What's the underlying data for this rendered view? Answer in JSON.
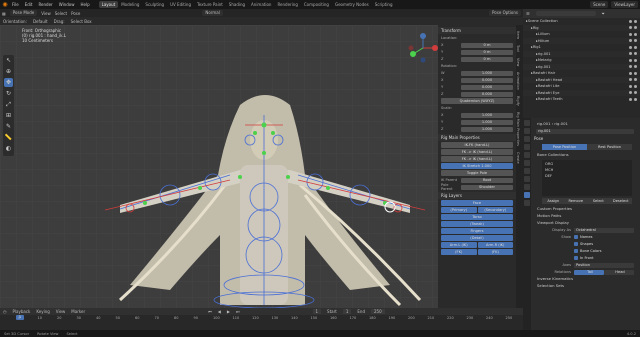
{
  "topbar": {
    "menus": [
      "File",
      "Edit",
      "Render",
      "Window",
      "Help"
    ],
    "workspaces": [
      "Layout",
      "Modeling",
      "Sculpting",
      "UV Editing",
      "Texture Paint",
      "Shading",
      "Animation",
      "Rendering",
      "Compositing",
      "Geometry Nodes",
      "Scripting"
    ],
    "active_workspace": "Layout",
    "scene": "Scene",
    "view_layer": "ViewLayer"
  },
  "header": {
    "mode": "Pose Mode",
    "view": "View",
    "select": "Select",
    "pose": "Pose",
    "orientation_label": "Orientation:",
    "orientation_value": "Default",
    "drag_label": "Drag:",
    "drag_value": "Select Box",
    "transform": "Normal",
    "pose_options": "Pose Options"
  },
  "viewport": {
    "info_line1": "Front: Orthographic",
    "info_line2": "(0) rig.001 : hand_ik.L",
    "info_line3": "10 Centimeters"
  },
  "npanel": {
    "transform_title": "Transform",
    "location_label": "Location:",
    "rotation_label": "Rotation:",
    "scale_label": "Scale:",
    "axes": [
      "X",
      "Y",
      "Z"
    ],
    "location_values": [
      "0 m",
      "0 m",
      "0 m"
    ],
    "rotation_w": "1.000",
    "rotation_values": [
      "0.000",
      "0.000",
      "0.000"
    ],
    "rotation_mode": "Quaternion (WXYZ)",
    "scale_values": [
      "1.000",
      "1.000",
      "1.000"
    ],
    "rig_main_title": "Rig Main Properties",
    "fk_ik_1": "FK -> IK (hand.L)",
    "fk_ik_2": "FK -> IK (hand.L)",
    "ik_switch_1": "IK-FK (hand.L)",
    "ik_switch_2": "IK Stretch",
    "ik_stretch_val": "1.000",
    "toggle_pole": "Toggle Pole",
    "ik_parent_label": "IK Parent",
    "ik_parent_val": "Root",
    "pole_parent_label": "Pole Parent",
    "pole_parent_val": "Shoulder",
    "rig_layers_title": "Rig Layers",
    "layers": [
      [
        "Face"
      ],
      [
        "(Primary)",
        "(Secondary)"
      ],
      [
        "Torso"
      ],
      [
        "(Tweak)"
      ],
      [
        "Fingers"
      ],
      [
        "(Detail)"
      ],
      [
        "Arm.L (IK)",
        "Arm.R (IK)"
      ],
      [
        "(FK)",
        "(FK)"
      ]
    ]
  },
  "side_tabs": [
    "Item",
    "Tool",
    "View",
    "Animation",
    "Rigify",
    "Rig Main Properties",
    "Create"
  ],
  "outliner": {
    "title": "Scene Collection",
    "rows": [
      {
        "label": "Scene Collection",
        "indent": 0,
        "sel": false
      },
      {
        "label": "Rig",
        "indent": 1,
        "sel": false
      },
      {
        "label": "Lillium",
        "indent": 2,
        "sel": false
      },
      {
        "label": "Hilium",
        "indent": 2,
        "sel": false
      },
      {
        "label": "Rig1",
        "indent": 1,
        "sel": false
      },
      {
        "label": "rig.001",
        "indent": 2,
        "sel": true
      },
      {
        "label": "Metarig",
        "indent": 2,
        "sel": false
      },
      {
        "label": "rig.001",
        "indent": 2,
        "sel": false
      },
      {
        "label": "Rastafri Hair",
        "indent": 1,
        "sel": false
      },
      {
        "label": "Rastafri Head",
        "indent": 2,
        "sel": false
      },
      {
        "label": "Rastafri Lite",
        "indent": 2,
        "sel": false
      },
      {
        "label": "Rastafri Eye",
        "indent": 2,
        "sel": false
      },
      {
        "label": "Rastafri Teeth",
        "indent": 2,
        "sel": false
      }
    ]
  },
  "properties": {
    "object_name": "rig.001",
    "data_name": "rig.001",
    "pose_title": "Pose",
    "pose_position": "Pose Position",
    "rest_position": "Rest Position",
    "bone_collections_title": "Bone Collections",
    "bone_collections": [
      "ORG",
      "MCH",
      "DEF"
    ],
    "bc_buttons": [
      "Assign",
      "Remove",
      "Select",
      "Deselect"
    ],
    "custom_properties": "Custom Properties",
    "motion_paths": "Motion Paths",
    "viewport_display": "Viewport Display",
    "display_as_label": "Display As",
    "display_as_value": "Octahedral",
    "show_label": "Show",
    "show_items": [
      "Names",
      "Shapes",
      "Bone Colors",
      "In Front"
    ],
    "axes_label": "Axes",
    "axes_value": "Position",
    "relations_label": "Relations",
    "relations_opts": [
      "Tail",
      "Head"
    ],
    "inverse_kinematics": "Inverse Kinematics",
    "selection_sets": "Selection Sets"
  },
  "timeline": {
    "menus": [
      "Playback",
      "Keying",
      "View",
      "Marker"
    ],
    "current_frame": "1",
    "start_label": "Start",
    "start": "1",
    "end_label": "End",
    "end": "250",
    "ticks": [
      "0",
      "10",
      "20",
      "30",
      "40",
      "50",
      "60",
      "70",
      "80",
      "90",
      "100",
      "110",
      "120",
      "130",
      "140",
      "150",
      "160",
      "170",
      "180",
      "190",
      "200",
      "210",
      "220",
      "230",
      "240",
      "250"
    ]
  },
  "status": {
    "items": [
      "Set 3D Cursor",
      "Rotate View",
      "Select"
    ],
    "version": "4.0.2"
  },
  "colors": {
    "accent": "#4772b3",
    "blender_orange": "#e87d0d"
  }
}
